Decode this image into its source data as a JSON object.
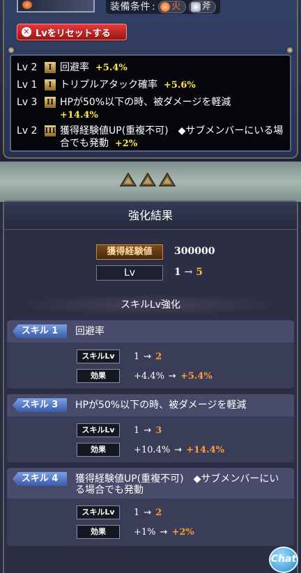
{
  "top": {
    "condition_label": "装備条件",
    "colon": ":",
    "attributes": [
      {
        "label": "火",
        "icon": "fire-icon",
        "color": "#ff7a3c"
      },
      {
        "label": "斧",
        "icon": "axe-icon",
        "color": "#e6e6ee"
      }
    ],
    "reset_button": "Lvをリセットする",
    "skills": [
      {
        "lv": "Lv 2",
        "rank": "I",
        "text": "回避率",
        "bonus": "+5.4%"
      },
      {
        "lv": "Lv 1",
        "rank": "I",
        "text": "トリプルアタック確率",
        "bonus": "+5.6%"
      },
      {
        "lv": "Lv 3",
        "rank": "II",
        "text": "HPが50%以下の時、被ダメージを軽減",
        "bonus": "+14.4%"
      },
      {
        "lv": "Lv 2",
        "rank": "III",
        "text": "獲得経験値UP(重複不可)　◆サブメンバーにいる場合でも発動",
        "bonus": "+2%"
      }
    ]
  },
  "result": {
    "title": "強化結果",
    "exp_label": "獲得経験値",
    "exp_value": "300000",
    "lv_label": "Lv",
    "lv_from": "1",
    "arrow": "→",
    "lv_to": "5",
    "skill_section_title": "スキルLv強化",
    "cards": [
      {
        "tag": "スキル 1",
        "name": "回避率",
        "skill_lv_label": "スキルLv",
        "lv_from": "1",
        "lv_to": "2",
        "effect_label": "効果",
        "effect_from": "+4.4%",
        "effect_to": "+5.4%"
      },
      {
        "tag": "スキル 3",
        "name": "HPが50%以下の時、被ダメージを軽減",
        "skill_lv_label": "スキルLv",
        "lv_from": "1",
        "lv_to": "3",
        "effect_label": "効果",
        "effect_from": "+10.4%",
        "effect_to": "+14.4%"
      },
      {
        "tag": "スキル 4",
        "name": "獲得経験値UP(重複不可)　◆サブメンバーにいる場合でも発動",
        "skill_lv_label": "スキルLv",
        "lv_from": "1",
        "lv_to": "2",
        "effect_label": "効果",
        "effect_from": "+1%",
        "effect_to": "+2%"
      }
    ]
  },
  "chat_button": "Chat",
  "colors": {
    "reset_red": "#c62222",
    "highlight_yellow": "#ffe94a",
    "highlight_orange": "#ff9a3a",
    "skill_tag_blue": "#5a7ac8"
  }
}
